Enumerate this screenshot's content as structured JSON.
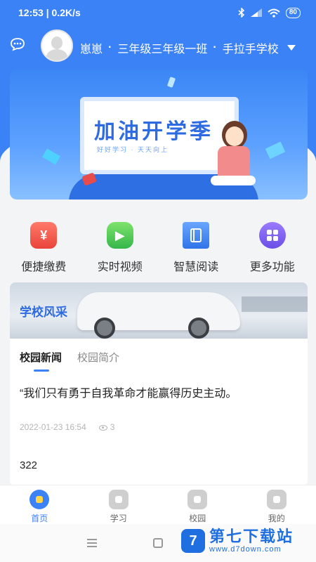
{
  "status_bar": {
    "time": "12:53",
    "speed": "0.2K/s",
    "battery": "80"
  },
  "header": {
    "name": "崽崽",
    "class": "三年级三年级一班",
    "school": "手拉手学校"
  },
  "banner": {
    "title": "加油开学季",
    "subtitle": "好好学习 · 天天向上"
  },
  "functions": [
    {
      "label": "便捷缴费",
      "icon": "payment-icon",
      "glyph": "¥"
    },
    {
      "label": "实时视频",
      "icon": "video-icon",
      "glyph": "▶"
    },
    {
      "label": "智慧阅读",
      "icon": "book-icon",
      "glyph": ""
    },
    {
      "label": "更多功能",
      "icon": "grid-icon",
      "glyph": "⁘"
    }
  ],
  "news": {
    "banner_title": "学校风采",
    "tabs": [
      "校园新闻",
      "校园简介"
    ],
    "active_tab": 0,
    "items": [
      {
        "title": "“我们只有勇于自我革命才能赢得历史主动。",
        "date": "2022-01-23 16:54",
        "views": "3"
      },
      {
        "title": "322"
      }
    ]
  },
  "bottom_nav": [
    {
      "label": "首页",
      "icon": "home-icon",
      "active": true
    },
    {
      "label": "学习",
      "icon": "study-icon",
      "active": false
    },
    {
      "label": "校园",
      "icon": "campus-icon",
      "active": false
    },
    {
      "label": "我的",
      "icon": "profile-icon",
      "active": false
    }
  ],
  "watermark": {
    "logo": "7",
    "title": "第七下载站",
    "url": "www.d7down.com"
  },
  "colors": {
    "primary": "#3b82f6",
    "background": "#f3f4f6"
  }
}
